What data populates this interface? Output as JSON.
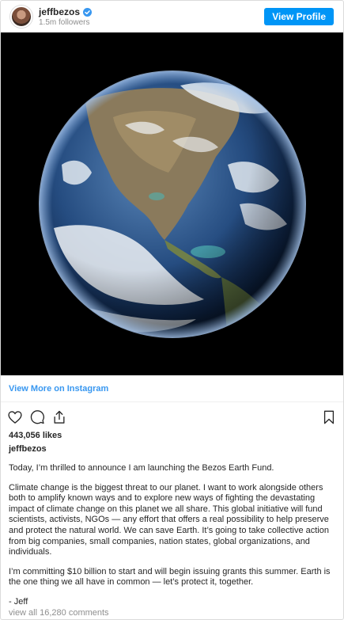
{
  "header": {
    "username": "jeffbezos",
    "followers": "1.5m followers",
    "view_profile_label": "View Profile"
  },
  "view_more_label": "View More on Instagram",
  "actions": {
    "icons": [
      "heart-icon",
      "comment-icon",
      "share-icon",
      "bookmark-icon"
    ]
  },
  "likes": "443,056 likes",
  "owner": "jeffbezos",
  "caption": {
    "p1": "Today, I’m thrilled to announce I am launching the Bezos Earth Fund.",
    "p2": "Climate change is the biggest threat to our planet. I want to work alongside others both to amplify known ways and to explore new ways of fighting the devastating impact of climate change on this planet we all share. This global initiative will fund scientists, activists, NGOs — any effort that offers a real possibility to help preserve and protect the natural world. We can save Earth. It’s going to take collective action from big companies, small companies, nation states, global organizations, and individuals.",
    "p3": "I’m committing $10 billion to start and will begin issuing grants this summer. Earth is the one thing we all have in common — let’s protect it, together.",
    "p4": "- Jeff"
  },
  "comments": "view all 16,280 comments",
  "colors": {
    "accent": "#0095f6",
    "link": "#3897f0",
    "muted": "#8e8e8e",
    "text": "#262626"
  }
}
